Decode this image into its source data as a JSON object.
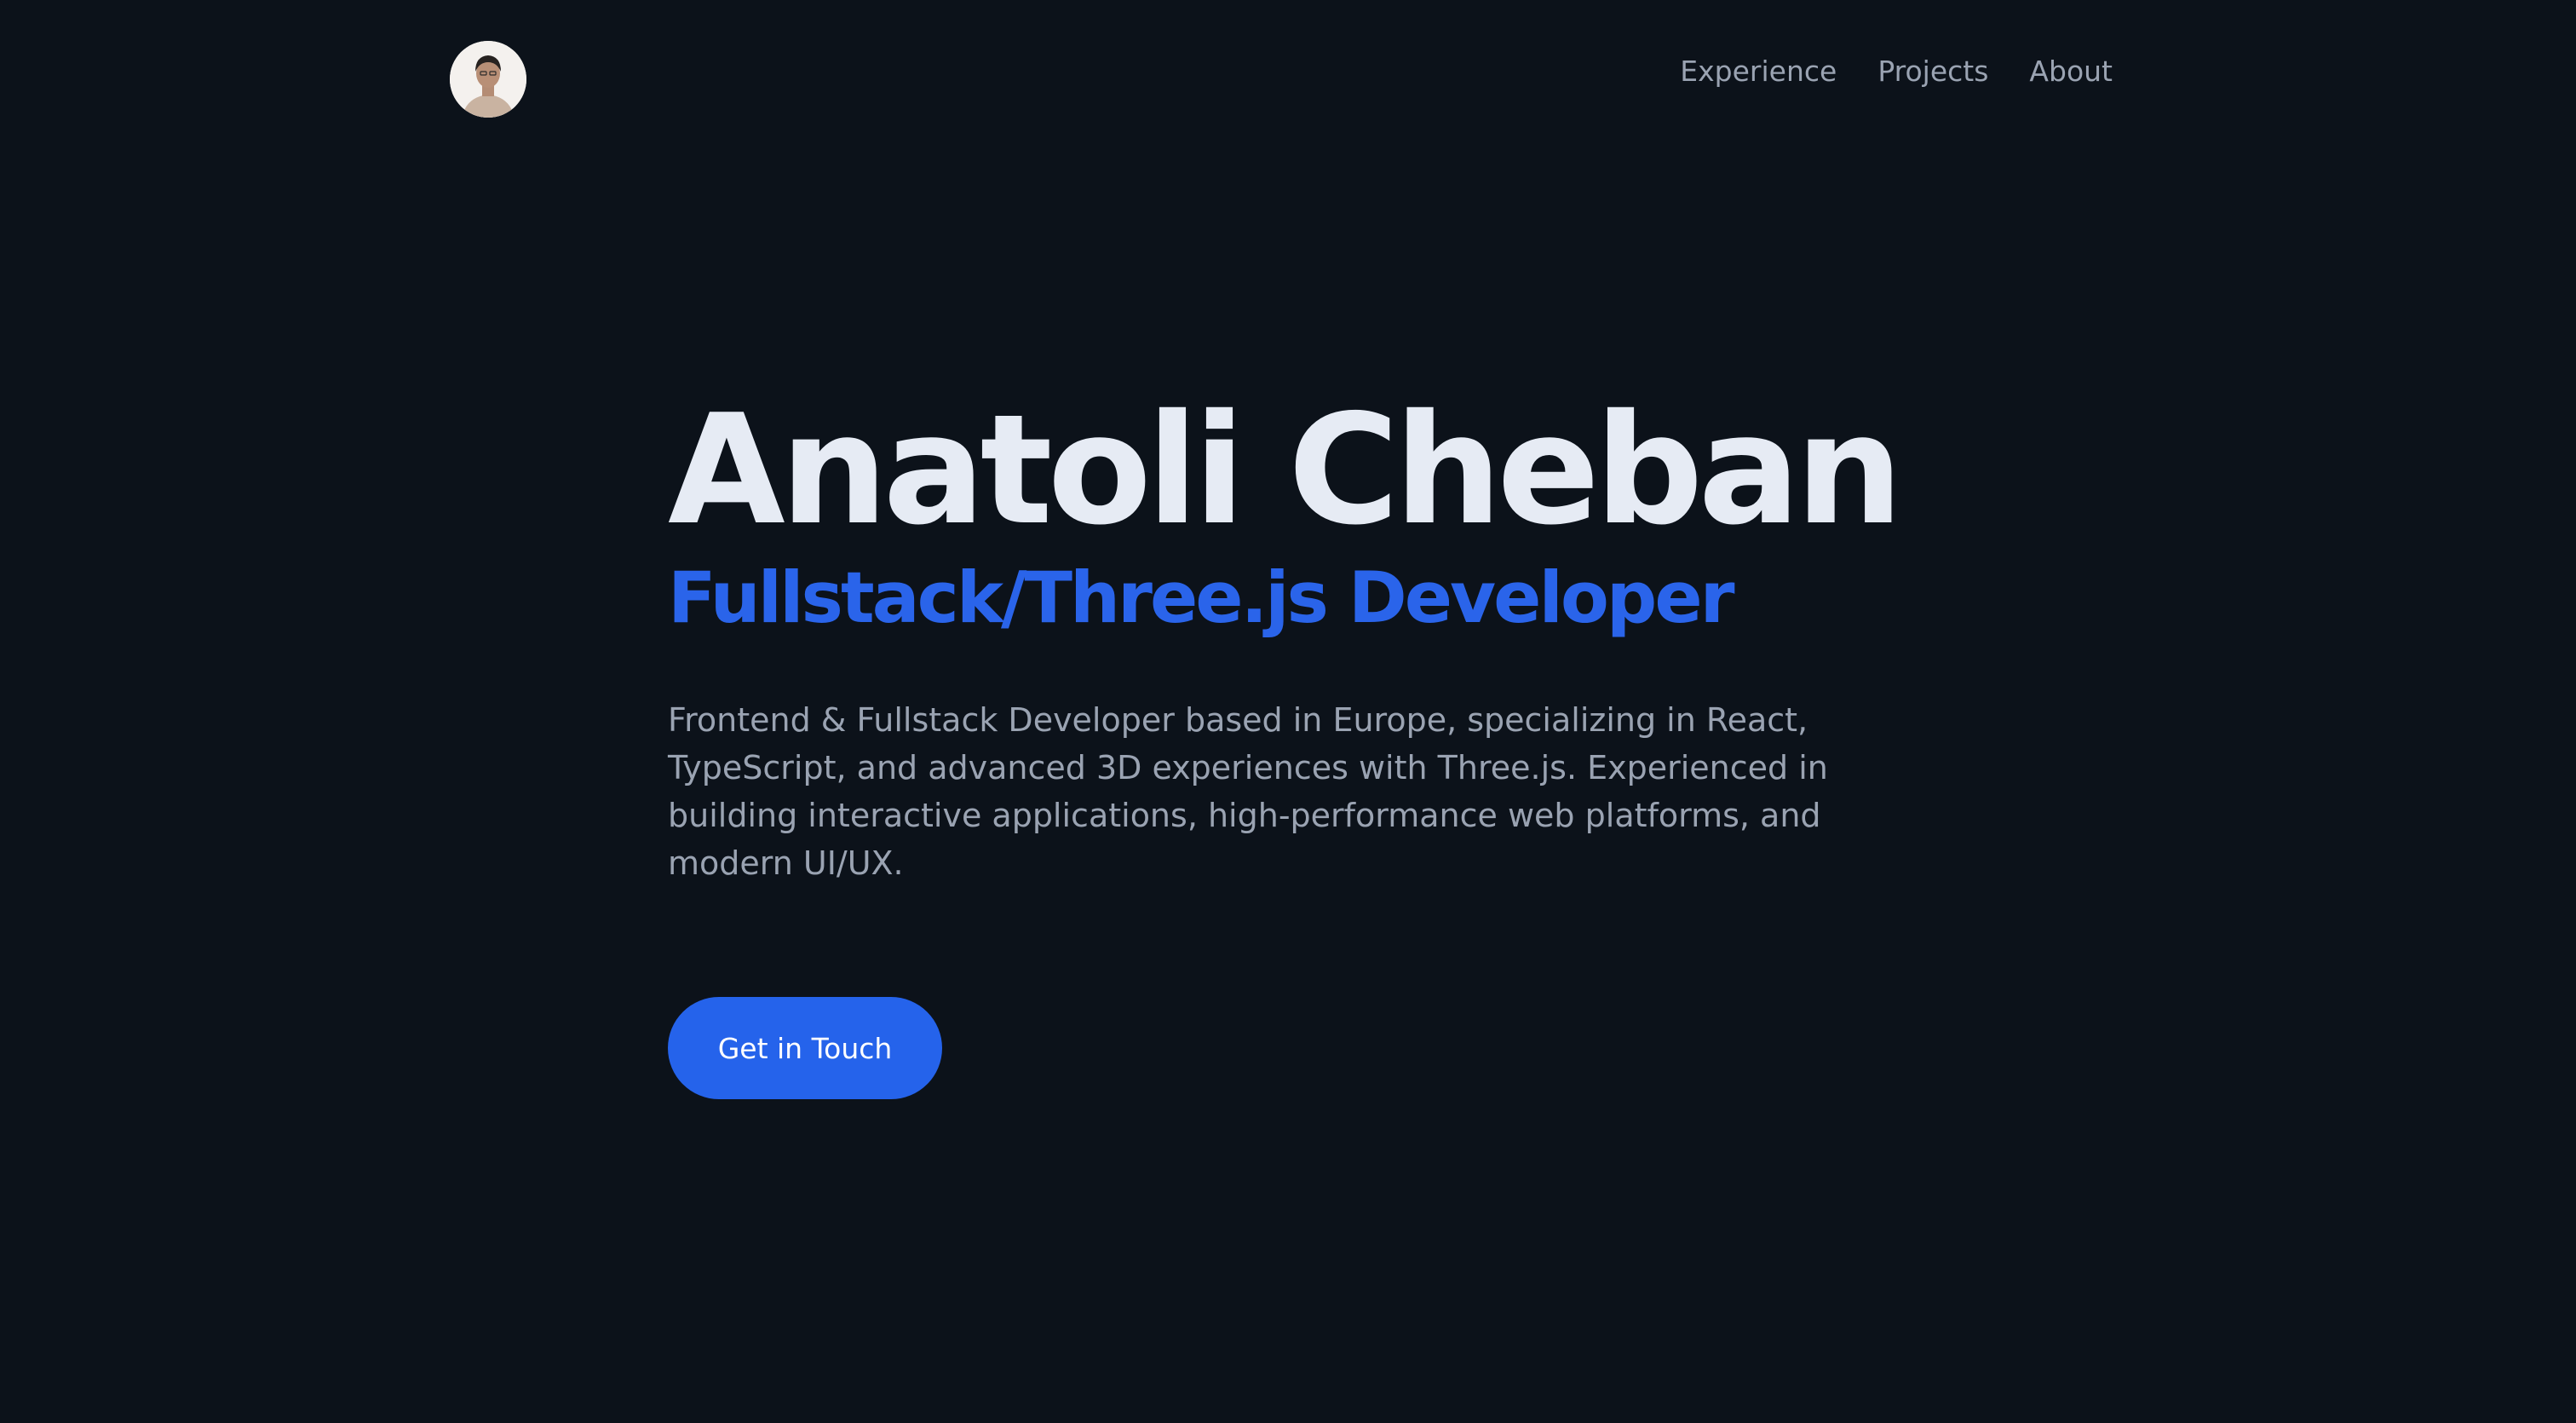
{
  "header": {
    "nav": [
      {
        "label": "Experience"
      },
      {
        "label": "Projects"
      },
      {
        "label": "About"
      }
    ]
  },
  "hero": {
    "name": "Anatoli Cheban",
    "role": "Fullstack/Three.js Developer",
    "description": "Frontend & Fullstack Developer based in Europe, specializing in React, TypeScript, and advanced 3D experiences with Three.js. Experienced in building interactive applications, high-performance web platforms, and modern UI/UX.",
    "cta_label": "Get in Touch"
  },
  "colors": {
    "background": "#0c121a",
    "heading": "#e6ebf4",
    "accent": "#2563eb",
    "muted_text": "#9aa3b2"
  }
}
